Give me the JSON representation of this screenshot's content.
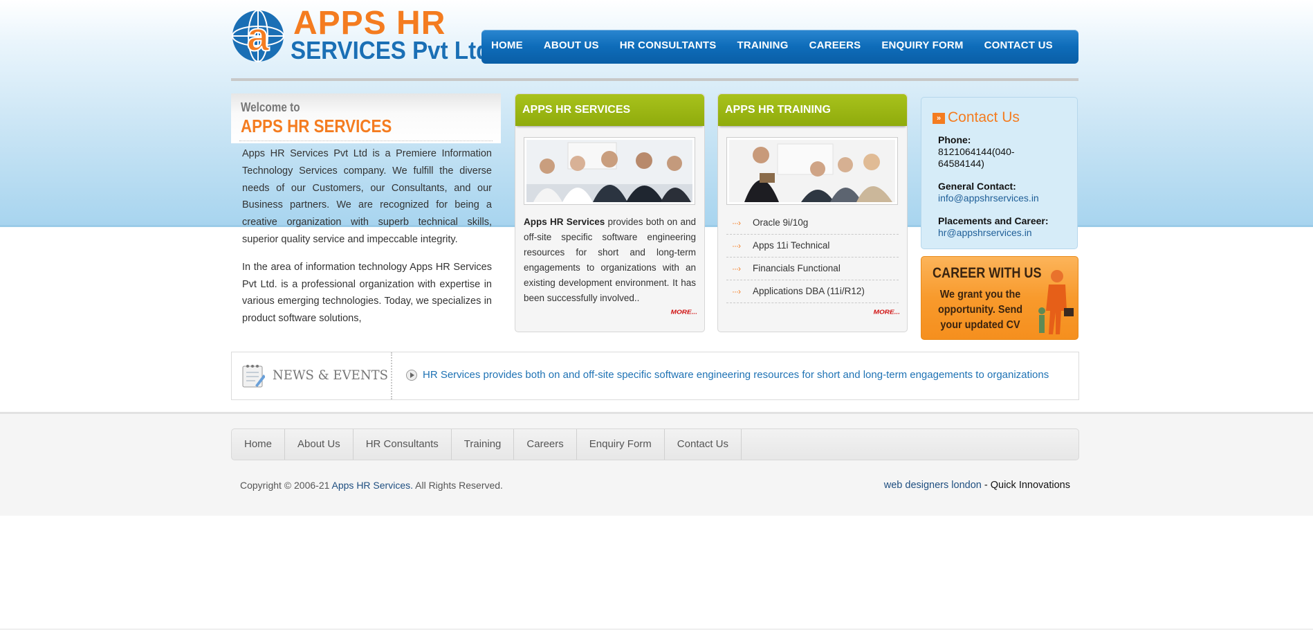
{
  "logo": {
    "line1": "APPS HR",
    "line2": "SERVICES Pvt Ltd"
  },
  "nav": [
    "HOME",
    "ABOUT US",
    "HR CONSULTANTS",
    "TRAINING",
    "CAREERS",
    "ENQUIRY FORM",
    "CONTACT US"
  ],
  "welcome": {
    "small": "Welcome to",
    "big": "APPS HR SERVICES",
    "p1": "Apps HR Services Pvt Ltd is a Premiere Information Technology Services company. We fulfill the diverse needs of our Customers, our Consultants, and our Business partners. We are recognized for being a creative organization with superb technical skills, superior quality service and impeccable integrity.",
    "p2": "In the area of information technology Apps HR Services Pvt Ltd. is a professional organization with expertise in various emerging technologies. Today, we specializes in product software solutions,"
  },
  "services": {
    "title": "APPS HR SERVICES",
    "lead": "Apps HR Services",
    "text": " provides both on and off-site specific software engineering resources for short and long-term engagements to organizations with an existing development environment. It has been successfully involved..",
    "more": "MORE..."
  },
  "training": {
    "title": "APPS HR TRAINING",
    "items": [
      "Oracle 9i/10g",
      "Apps 11i Technical",
      "Financials Functional",
      "Applications DBA (11i/R12)"
    ],
    "more": "MORE..."
  },
  "contact": {
    "title": "Contact Us",
    "phone_label": "Phone:",
    "phone": "8121064144(040-64584144)",
    "general_label": "General Contact:",
    "general_email": "info@appshrservices.in",
    "placements_label": "Placements and Career:",
    "placements_email": "hr@appshrservices.in"
  },
  "career": {
    "title": "CAREER WITH US",
    "text": "We grant you the opportunity. Send your updated CV"
  },
  "news": {
    "label": "NEWS & EVENTS",
    "text": "HR Services provides both on and off-site specific software engineering resources for short and long-term engagements to organizations"
  },
  "footer_nav": [
    "Home",
    "About Us",
    "HR Consultants",
    "Training",
    "Careers",
    "Enquiry Form",
    "Contact Us"
  ],
  "footer": {
    "copyright_prefix": "Copyright © 2006-21 ",
    "copyright_link": "Apps HR Services.",
    "copyright_suffix": " All Rights Reserved.",
    "credit_link": "web designers london",
    "credit_suffix": " - Quick Innovations"
  },
  "colors": {
    "brand_orange": "#f47c20",
    "brand_blue": "#0e6cb9",
    "box_green": "#9ab814"
  }
}
